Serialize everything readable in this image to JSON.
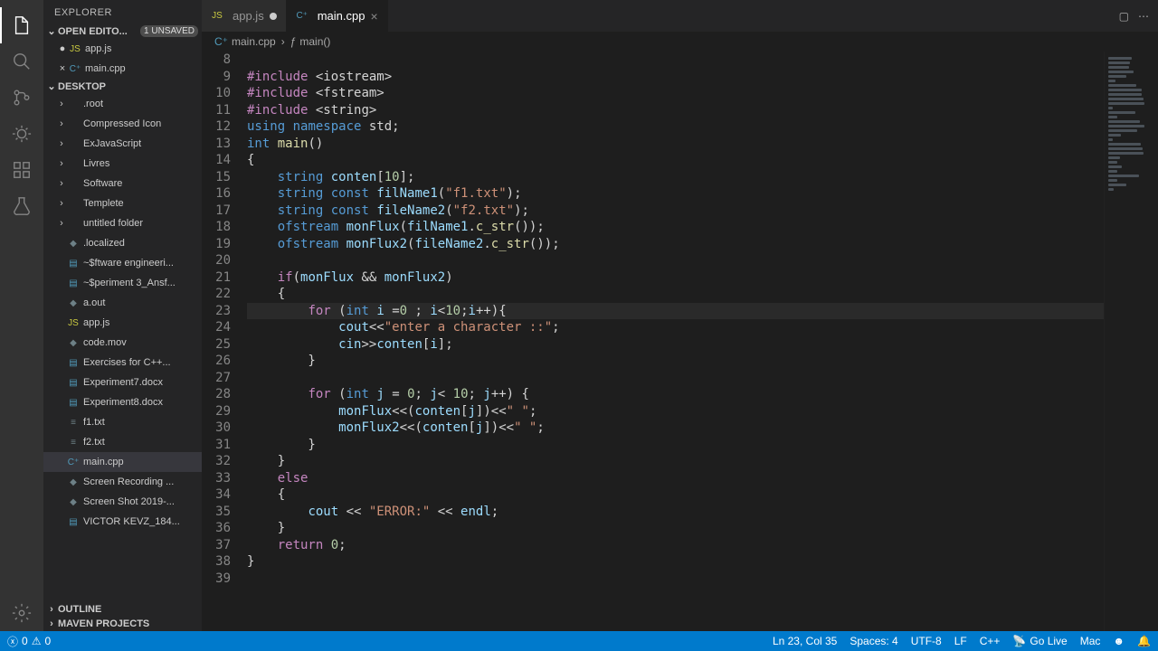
{
  "explorer": {
    "title": "EXPLORER",
    "openEditors": {
      "label": "OPEN EDITO...",
      "badge": "1 UNSAVED"
    },
    "openEditorsItems": [
      {
        "name": "app.js",
        "icon": "js",
        "unsaved": true
      },
      {
        "name": "main.cpp",
        "icon": "cpp",
        "close": true
      }
    ],
    "workspace": "DESKTOP",
    "tree": [
      {
        "name": ".root",
        "icon": "folder",
        "depth": 1,
        "collapsed": true
      },
      {
        "name": "Compressed Icon",
        "icon": "folder",
        "depth": 1,
        "collapsed": true
      },
      {
        "name": "ExJavaScript",
        "icon": "folder",
        "depth": 1,
        "collapsed": true
      },
      {
        "name": "Livres",
        "icon": "folder",
        "depth": 1,
        "collapsed": true
      },
      {
        "name": "Software",
        "icon": "folder",
        "depth": 1,
        "collapsed": true
      },
      {
        "name": "Templete",
        "icon": "folder",
        "depth": 1,
        "collapsed": true
      },
      {
        "name": "untitled folder",
        "icon": "folder",
        "depth": 1,
        "collapsed": true
      },
      {
        "name": ".localized",
        "icon": "gen",
        "depth": 1
      },
      {
        "name": "~$ftware engineeri...",
        "icon": "doc",
        "depth": 1
      },
      {
        "name": "~$periment 3_Ansf...",
        "icon": "doc",
        "depth": 1
      },
      {
        "name": "a.out",
        "icon": "gen",
        "depth": 1
      },
      {
        "name": "app.js",
        "icon": "js",
        "depth": 1
      },
      {
        "name": "code.mov",
        "icon": "gen",
        "depth": 1
      },
      {
        "name": "Exercises for C++...",
        "icon": "doc",
        "depth": 1
      },
      {
        "name": "Experiment7.docx",
        "icon": "doc",
        "depth": 1
      },
      {
        "name": "Experiment8.docx",
        "icon": "doc",
        "depth": 1
      },
      {
        "name": "f1.txt",
        "icon": "txt",
        "depth": 1
      },
      {
        "name": "f2.txt",
        "icon": "txt",
        "depth": 1
      },
      {
        "name": "main.cpp",
        "icon": "cpp",
        "depth": 1,
        "active": true
      },
      {
        "name": "Screen Recording ...",
        "icon": "gen",
        "depth": 1
      },
      {
        "name": "Screen Shot 2019-...",
        "icon": "gen",
        "depth": 1
      },
      {
        "name": "VICTOR KEVZ_184...",
        "icon": "doc",
        "depth": 1
      }
    ],
    "outline": "OUTLINE",
    "maven": "MAVEN PROJECTS"
  },
  "tabs": [
    {
      "label": "app.js",
      "icon": "js",
      "active": false,
      "dirty": true
    },
    {
      "label": "main.cpp",
      "icon": "cpp",
      "active": true,
      "dirty": false
    }
  ],
  "breadcrumbs": [
    {
      "label": "main.cpp",
      "icon": "cpp"
    },
    {
      "label": "main()",
      "icon": "func"
    }
  ],
  "code": {
    "firstLine": 8,
    "lines": [
      {
        "n": 8,
        "raw": ""
      },
      {
        "n": 9,
        "t": [
          [
            "mag",
            "#include"
          ],
          [
            "op",
            " <iostream>"
          ]
        ]
      },
      {
        "n": 10,
        "t": [
          [
            "mag",
            "#include"
          ],
          [
            "op",
            " <fstream>"
          ]
        ]
      },
      {
        "n": 11,
        "t": [
          [
            "mag",
            "#include"
          ],
          [
            "op",
            " <string>"
          ]
        ]
      },
      {
        "n": 12,
        "t": [
          [
            "key",
            "using"
          ],
          [
            "op",
            " "
          ],
          [
            "key",
            "namespace"
          ],
          [
            "op",
            " std;"
          ]
        ]
      },
      {
        "n": 13,
        "t": [
          [
            "type",
            "int"
          ],
          [
            "op",
            " "
          ],
          [
            "func",
            "main"
          ],
          [
            "op",
            "()"
          ]
        ]
      },
      {
        "n": 14,
        "t": [
          [
            "op",
            "{"
          ]
        ]
      },
      {
        "n": 15,
        "t": [
          [
            "op",
            "    "
          ],
          [
            "type",
            "string"
          ],
          [
            "op",
            " "
          ],
          [
            "var",
            "conten"
          ],
          [
            "op",
            "["
          ],
          [
            "num",
            "10"
          ],
          [
            "op",
            "];"
          ]
        ]
      },
      {
        "n": 16,
        "t": [
          [
            "op",
            "    "
          ],
          [
            "type",
            "string"
          ],
          [
            "op",
            " "
          ],
          [
            "key",
            "const"
          ],
          [
            "op",
            " "
          ],
          [
            "var",
            "filName1"
          ],
          [
            "op",
            "("
          ],
          [
            "str",
            "\"f1.txt\""
          ],
          [
            "op",
            ");"
          ]
        ]
      },
      {
        "n": 17,
        "t": [
          [
            "op",
            "    "
          ],
          [
            "type",
            "string"
          ],
          [
            "op",
            " "
          ],
          [
            "key",
            "const"
          ],
          [
            "op",
            " "
          ],
          [
            "var",
            "fileName2"
          ],
          [
            "op",
            "("
          ],
          [
            "str",
            "\"f2.txt\""
          ],
          [
            "op",
            ");"
          ]
        ]
      },
      {
        "n": 18,
        "t": [
          [
            "op",
            "    "
          ],
          [
            "type",
            "ofstream"
          ],
          [
            "op",
            " "
          ],
          [
            "var",
            "monFlux"
          ],
          [
            "op",
            "("
          ],
          [
            "var",
            "filName1"
          ],
          [
            "op",
            "."
          ],
          [
            "func",
            "c_str"
          ],
          [
            "op",
            "());"
          ]
        ]
      },
      {
        "n": 19,
        "t": [
          [
            "op",
            "    "
          ],
          [
            "type",
            "ofstream"
          ],
          [
            "op",
            " "
          ],
          [
            "var",
            "monFlux2"
          ],
          [
            "op",
            "("
          ],
          [
            "var",
            "fileName2"
          ],
          [
            "op",
            "."
          ],
          [
            "func",
            "c_str"
          ],
          [
            "op",
            "());"
          ]
        ]
      },
      {
        "n": 20,
        "raw": ""
      },
      {
        "n": 21,
        "t": [
          [
            "op",
            "    "
          ],
          [
            "mag",
            "if"
          ],
          [
            "op",
            "("
          ],
          [
            "var",
            "monFlux"
          ],
          [
            "op",
            " && "
          ],
          [
            "var",
            "monFlux2"
          ],
          [
            "op",
            ")"
          ]
        ]
      },
      {
        "n": 22,
        "t": [
          [
            "op",
            "    {"
          ]
        ]
      },
      {
        "n": 23,
        "hl": true,
        "t": [
          [
            "op",
            "        "
          ],
          [
            "mag",
            "for"
          ],
          [
            "op",
            " ("
          ],
          [
            "type",
            "int"
          ],
          [
            "op",
            " "
          ],
          [
            "var",
            "i"
          ],
          [
            "op",
            " ="
          ],
          [
            "num",
            "0"
          ],
          [
            "op",
            " ; "
          ],
          [
            "var",
            "i"
          ],
          [
            "op",
            "<"
          ],
          [
            "num",
            "10"
          ],
          [
            "op",
            ";"
          ],
          [
            "var",
            "i"
          ],
          [
            "op",
            "++){"
          ]
        ]
      },
      {
        "n": 24,
        "t": [
          [
            "op",
            "            "
          ],
          [
            "var",
            "cout"
          ],
          [
            "op",
            "<<"
          ],
          [
            "str",
            "\"enter a character ::\""
          ],
          [
            "op",
            ";"
          ]
        ]
      },
      {
        "n": 25,
        "t": [
          [
            "op",
            "            "
          ],
          [
            "var",
            "cin"
          ],
          [
            "op",
            ">>"
          ],
          [
            "var",
            "conten"
          ],
          [
            "op",
            "["
          ],
          [
            "var",
            "i"
          ],
          [
            "op",
            "];"
          ]
        ]
      },
      {
        "n": 26,
        "t": [
          [
            "op",
            "        }"
          ]
        ]
      },
      {
        "n": 27,
        "raw": ""
      },
      {
        "n": 28,
        "t": [
          [
            "op",
            "        "
          ],
          [
            "mag",
            "for"
          ],
          [
            "op",
            " ("
          ],
          [
            "type",
            "int"
          ],
          [
            "op",
            " "
          ],
          [
            "var",
            "j"
          ],
          [
            "op",
            " = "
          ],
          [
            "num",
            "0"
          ],
          [
            "op",
            "; "
          ],
          [
            "var",
            "j"
          ],
          [
            "op",
            "< "
          ],
          [
            "num",
            "10"
          ],
          [
            "op",
            "; "
          ],
          [
            "var",
            "j"
          ],
          [
            "op",
            "++) {"
          ]
        ]
      },
      {
        "n": 29,
        "t": [
          [
            "op",
            "            "
          ],
          [
            "var",
            "monFlux"
          ],
          [
            "op",
            "<<("
          ],
          [
            "var",
            "conten"
          ],
          [
            "op",
            "["
          ],
          [
            "var",
            "j"
          ],
          [
            "op",
            "])<<"
          ],
          [
            "str",
            "\" \""
          ],
          [
            "op",
            ";"
          ]
        ]
      },
      {
        "n": 30,
        "t": [
          [
            "op",
            "            "
          ],
          [
            "var",
            "monFlux2"
          ],
          [
            "op",
            "<<("
          ],
          [
            "var",
            "conten"
          ],
          [
            "op",
            "["
          ],
          [
            "var",
            "j"
          ],
          [
            "op",
            "])<<"
          ],
          [
            "str",
            "\" \""
          ],
          [
            "op",
            ";"
          ]
        ]
      },
      {
        "n": 31,
        "t": [
          [
            "op",
            "        }"
          ]
        ]
      },
      {
        "n": 32,
        "t": [
          [
            "op",
            "    }"
          ]
        ]
      },
      {
        "n": 33,
        "t": [
          [
            "op",
            "    "
          ],
          [
            "mag",
            "else"
          ]
        ]
      },
      {
        "n": 34,
        "t": [
          [
            "op",
            "    {"
          ]
        ]
      },
      {
        "n": 35,
        "t": [
          [
            "op",
            "        "
          ],
          [
            "var",
            "cout"
          ],
          [
            "op",
            " << "
          ],
          [
            "str",
            "\"ERROR:\""
          ],
          [
            "op",
            " << "
          ],
          [
            "var",
            "endl"
          ],
          [
            "op",
            ";"
          ]
        ]
      },
      {
        "n": 36,
        "t": [
          [
            "op",
            "    }"
          ]
        ]
      },
      {
        "n": 37,
        "t": [
          [
            "op",
            "    "
          ],
          [
            "mag",
            "return"
          ],
          [
            "op",
            " "
          ],
          [
            "num",
            "0"
          ],
          [
            "op",
            ";"
          ]
        ]
      },
      {
        "n": 38,
        "t": [
          [
            "op",
            "}"
          ]
        ]
      },
      {
        "n": 39,
        "raw": ""
      }
    ]
  },
  "status": {
    "errors": "0",
    "warnings": "0",
    "lncol": "Ln 23, Col 35",
    "spaces": "Spaces: 4",
    "encoding": "UTF-8",
    "eol": "LF",
    "lang": "C++",
    "golive": "Go Live",
    "os": "Mac"
  }
}
